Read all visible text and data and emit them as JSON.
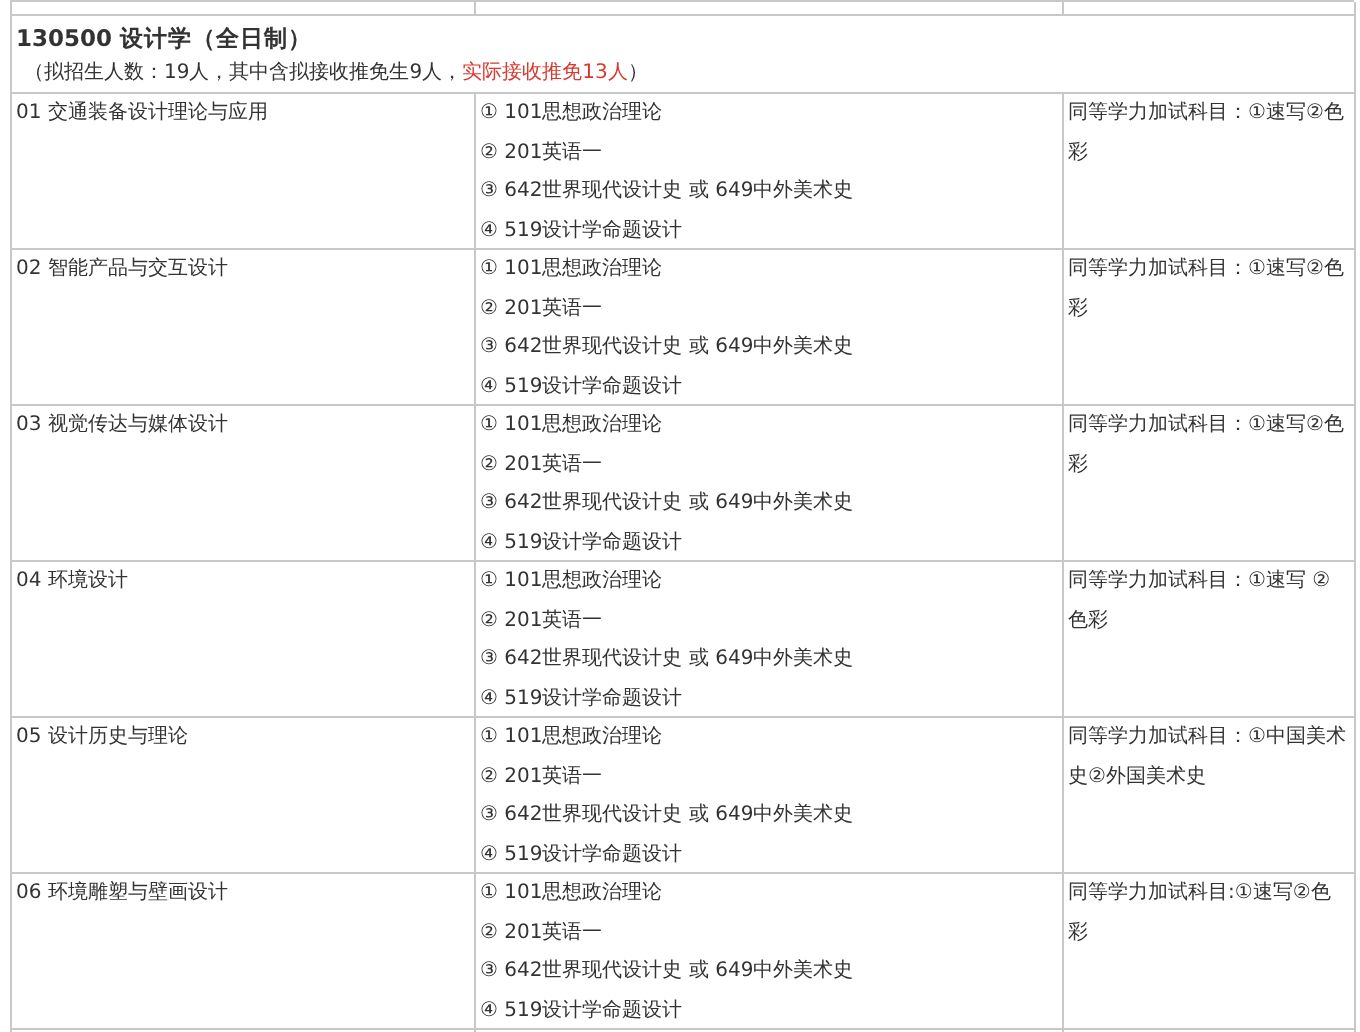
{
  "program": {
    "title": "130500 设计学（全日制）",
    "note": [
      {
        "text": "（拟招生人数：19人，其中含拟接收推免生9人，",
        "highlight": false
      },
      {
        "text": "实际接收推免13人",
        "highlight": true
      },
      {
        "text": "）",
        "highlight": false
      }
    ]
  },
  "rows": [
    {
      "direction": "01 交通装备设计理论与应用",
      "subjects": [
        "① 101思想政治理论",
        "② 201英语一",
        "③ 642世界现代设计史 或 649中外美术史",
        "④ 519设计学命题设计"
      ],
      "extra": "同等学力加试科目：①速写②色彩"
    },
    {
      "direction": "02 智能产品与交互设计",
      "subjects": [
        "① 101思想政治理论",
        "② 201英语一",
        "③ 642世界现代设计史 或 649中外美术史",
        "④ 519设计学命题设计"
      ],
      "extra": "同等学力加试科目：①速写②色彩"
    },
    {
      "direction": "03 视觉传达与媒体设计",
      "subjects": [
        "① 101思想政治理论",
        "② 201英语一",
        "③ 642世界现代设计史 或 649中外美术史",
        "④ 519设计学命题设计"
      ],
      "extra": "同等学力加试科目：①速写②色彩"
    },
    {
      "direction": "04 环境设计",
      "subjects": [
        "① 101思想政治理论",
        "② 201英语一",
        "③ 642世界现代设计史 或 649中外美术史",
        "④ 519设计学命题设计"
      ],
      "extra": "同等学力加试科目：①速写 ②色彩"
    },
    {
      "direction": "05 设计历史与理论",
      "subjects": [
        "① 101思想政治理论",
        "② 201英语一",
        "③ 642世界现代设计史 或 649中外美术史",
        "④ 519设计学命题设计"
      ],
      "extra": "同等学力加试科目：①中国美术史②外国美术史"
    },
    {
      "direction": "06 环境雕塑与壁画设计",
      "subjects": [
        "① 101思想政治理论",
        "② 201英语一",
        "③ 642世界现代设计史 或 649中外美术史",
        "④ 519设计学命题设计"
      ],
      "extra": "同等学力加试科目:①速写②色彩"
    }
  ]
}
